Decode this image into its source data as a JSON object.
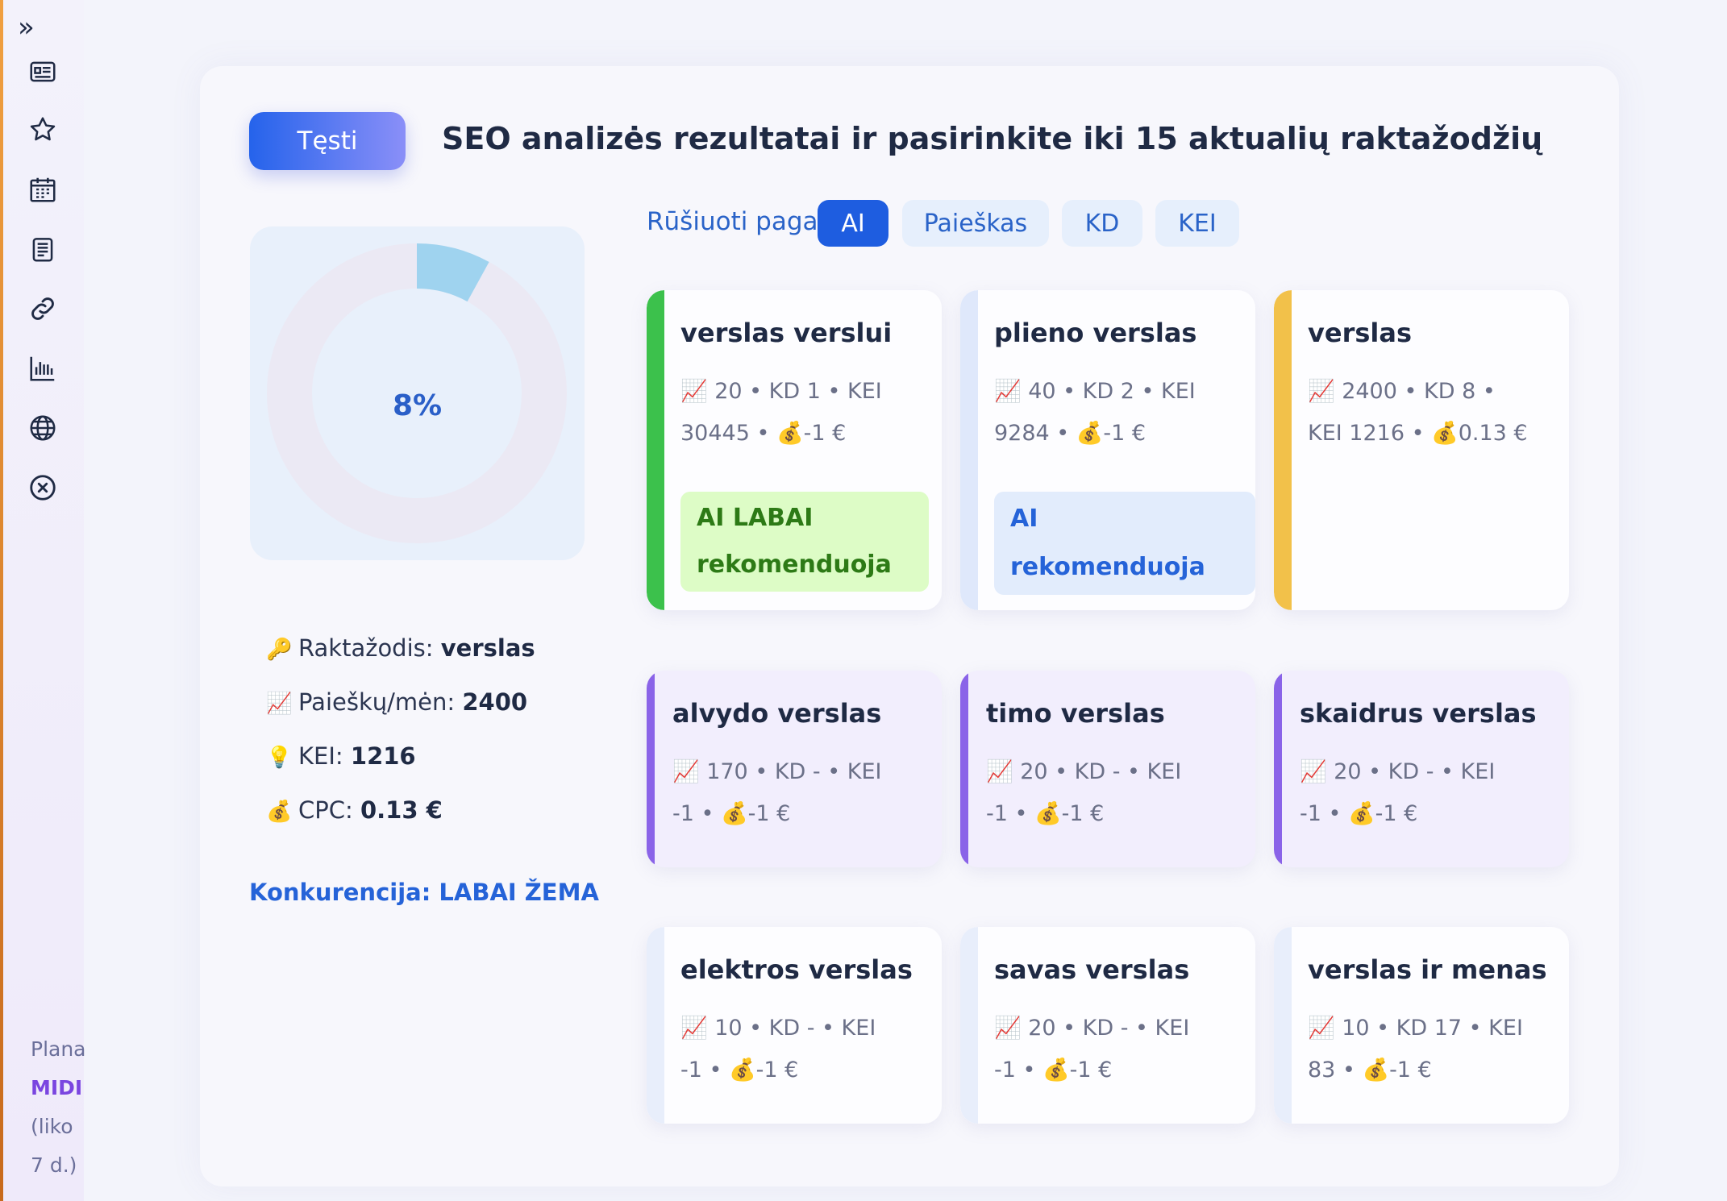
{
  "sidebar": {
    "toggle_icon": "»",
    "icons": [
      "newspaper-icon",
      "star-icon",
      "calendar-icon",
      "document-icon",
      "link-icon",
      "bar-chart-icon",
      "globe-icon",
      "close-circle-icon"
    ],
    "plan_label": "Planas",
    "plan_name": "MIDI",
    "plan_remaining_1": "(liko",
    "plan_remaining_2": "7 d.)"
  },
  "header": {
    "continue_label": "Tęsti",
    "title": "SEO analizės rezultatai ir pasirinkite iki 15 aktualių raktažodžių"
  },
  "donut": {
    "percent_label": "8%",
    "value": 8,
    "track_color": "#ebe9f4",
    "fill_color": "#9fd3ef"
  },
  "summary": {
    "keyword_label": "Raktažodis:",
    "keyword_value": "verslas",
    "searches_label": "Paieškų/mėn:",
    "searches_value": "2400",
    "kei_label": "KEI:",
    "kei_value": "1216",
    "cpc_label": "CPC:",
    "cpc_value": "0.13 €",
    "competition": "Konkurencija: LABAI ŽEMA"
  },
  "sort": {
    "label": "Rūšiuoti pagal:",
    "options": [
      "AI",
      "Paieškas",
      "KD",
      "KEI"
    ],
    "active": "AI"
  },
  "cards": [
    {
      "title": "verslas verslui",
      "line1": "📈 20  •  KD 1  •  KEI",
      "line2": "30445  •  💰-1 €",
      "badge": "AI LABAI rekomenduoja",
      "accent": "#3cc14c"
    },
    {
      "title": "plieno verslas",
      "line1": "📈 40  •  KD 2  •  KEI",
      "line2": "9284  •  💰-1 €",
      "badge": "AI rekomenduoja",
      "accent": "#dfe8fb"
    },
    {
      "title": "verslas",
      "line1": "📈 2400  •  KD 8  •",
      "line2": "KEI 1216  •  💰0.13 €",
      "badge": "",
      "accent": "#f2c14a"
    },
    {
      "title": "alvydo verslas",
      "line1": "📈 170  •  KD -  •  KEI",
      "line2": "-1  •  💰-1 €",
      "badge": "",
      "accent": "#8a63e8"
    },
    {
      "title": "timo verslas",
      "line1": "📈 20  •  KD -  •  KEI",
      "line2": "-1  •  💰-1 €",
      "badge": "",
      "accent": "#8a63e8"
    },
    {
      "title": "skaidrus verslas",
      "line1": "📈 20  •  KD -  •  KEI",
      "line2": "-1  •  💰-1 €",
      "badge": "",
      "accent": "#8a63e8"
    },
    {
      "title": "elektros verslas",
      "line1": "📈 10  •  KD -  •  KEI",
      "line2": "-1  •  💰-1 €",
      "badge": "",
      "accent": "#e8eefb"
    },
    {
      "title": "savas verslas",
      "line1": "📈 20  •  KD -  •  KEI",
      "line2": "-1  •  💰-1 €",
      "badge": "",
      "accent": "#e8eefb"
    },
    {
      "title": "verslas ir menas",
      "line1": "📈 10  •  KD 17  •  KEI",
      "line2": "83  •  💰-1 €",
      "badge": "",
      "accent": "#e8eefb"
    }
  ]
}
